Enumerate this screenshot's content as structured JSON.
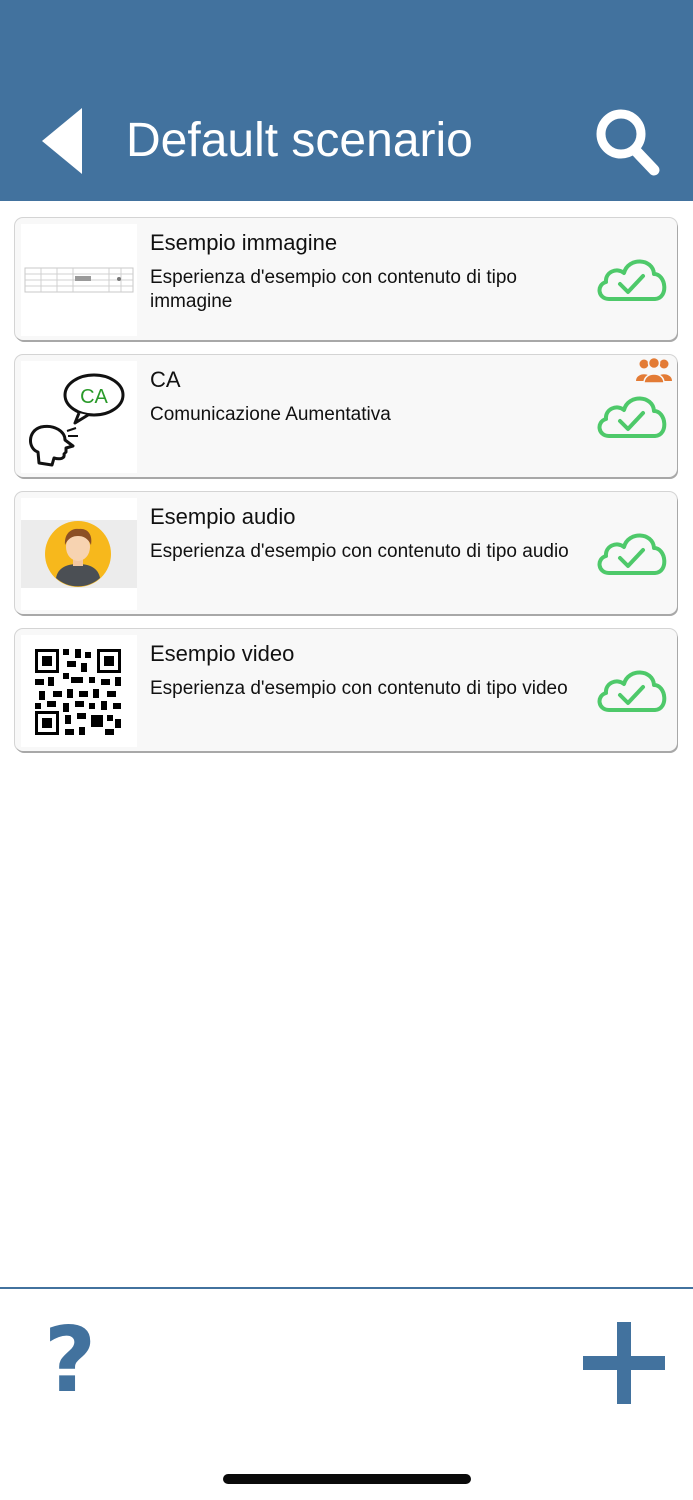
{
  "header": {
    "title": "Default scenario",
    "back_icon": "back-triangle-icon",
    "search_icon": "search-icon",
    "background": "#42729e"
  },
  "experiences": [
    {
      "title": "Esempio immagine",
      "description": "Esperienza d'esempio con contenuto di tipo immagine",
      "thumbnail": "image-thumbnail",
      "status_icon": "cloud-check-icon",
      "shared": false
    },
    {
      "title": "CA",
      "description": "Comunicazione Aumentativa",
      "thumbnail": "speech-bubble-thumbnail",
      "thumbnail_text": "CA",
      "status_icon": "cloud-check-icon",
      "shared": true,
      "shared_icon": "group-icon"
    },
    {
      "title": "Esempio audio",
      "description": "Esperienza d'esempio con contenuto di tipo audio",
      "thumbnail": "avatar-thumbnail",
      "status_icon": "cloud-check-icon",
      "shared": false
    },
    {
      "title": "Esempio video",
      "description": "Esperienza d'esempio con contenuto di tipo video",
      "thumbnail": "qr-code-thumbnail",
      "status_icon": "cloud-check-icon",
      "shared": false
    }
  ],
  "footer": {
    "help_label": "?",
    "help_icon": "help-icon",
    "add_icon": "plus-icon"
  },
  "colors": {
    "primary": "#42729e",
    "synced": "#4ec96a",
    "shared": "#e37b35",
    "ca_text": "#2a9a2a"
  }
}
